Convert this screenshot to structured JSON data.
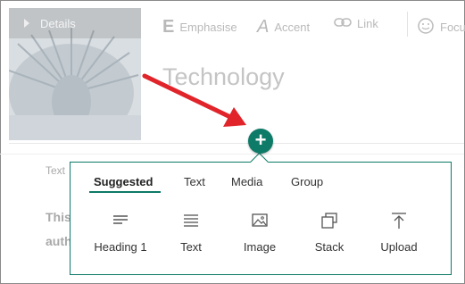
{
  "details": {
    "label": "Details"
  },
  "toolbar": {
    "emphasise": "Emphasise",
    "accent": "Accent",
    "link": "Link",
    "focus": "Focu"
  },
  "page_title": "Technology",
  "background_text": {
    "text_label": "Text",
    "line1": "This",
    "line2": "auth"
  },
  "panel": {
    "tabs": [
      {
        "label": "Suggested",
        "active": true
      },
      {
        "label": "Text",
        "active": false
      },
      {
        "label": "Media",
        "active": false
      },
      {
        "label": "Group",
        "active": false
      }
    ],
    "options": [
      {
        "label": "Heading 1",
        "icon": "heading-icon"
      },
      {
        "label": "Text",
        "icon": "text-lines-icon"
      },
      {
        "label": "Image",
        "icon": "image-icon"
      },
      {
        "label": "Stack",
        "icon": "stack-icon"
      },
      {
        "label": "Upload",
        "icon": "upload-icon"
      }
    ]
  },
  "colors": {
    "accent": "#0e7a68",
    "arrow": "#e0242a"
  }
}
